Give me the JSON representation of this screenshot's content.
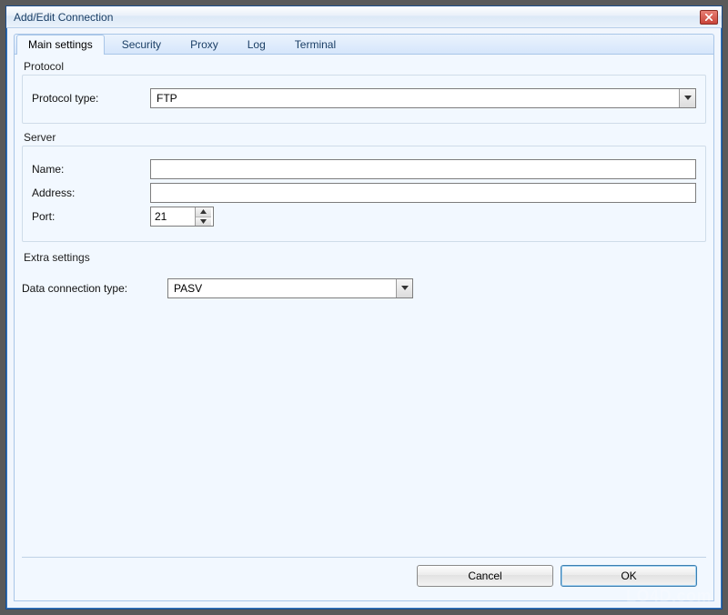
{
  "window": {
    "title": "Add/Edit Connection"
  },
  "tabs": [
    {
      "label": "Main settings"
    },
    {
      "label": "Security"
    },
    {
      "label": "Proxy"
    },
    {
      "label": "Log"
    },
    {
      "label": "Terminal"
    }
  ],
  "active_tab_index": 0,
  "protocol_group": {
    "title": "Protocol",
    "type_label": "Protocol type:",
    "type_value": "FTP"
  },
  "server_group": {
    "title": "Server",
    "name_label": "Name:",
    "name_value": "",
    "address_label": "Address:",
    "address_value": "",
    "port_label": "Port:",
    "port_value": "21"
  },
  "extra_group": {
    "title": "Extra settings",
    "dct_label": "Data connection type:",
    "dct_value": "PASV"
  },
  "buttons": {
    "cancel": "Cancel",
    "ok": "OK"
  },
  "watermark": "LO4D.com"
}
